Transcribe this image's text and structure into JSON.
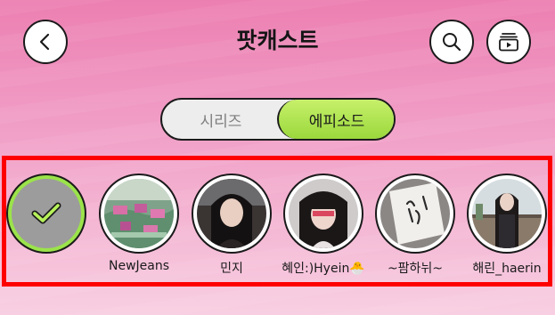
{
  "header": {
    "title": "팟캐스트",
    "back_icon": "chevron-left-icon",
    "search_icon": "search-icon",
    "playlist_icon": "playlist-icon"
  },
  "tabs": {
    "series_label": "시리즈",
    "episode_label": "에피소드",
    "selected": "에피소드"
  },
  "filters": {
    "all_icon": "check-icon",
    "profiles": [
      {
        "name": "NewJeans"
      },
      {
        "name": "민지"
      },
      {
        "name": "혜인:)Hyein🐣"
      },
      {
        "name": "~팜하뉘~"
      },
      {
        "name": "해린_haerin"
      }
    ]
  },
  "colors": {
    "accent_green": "#9be34a",
    "highlight_red": "#ff0000",
    "background_pink": "#ef8fbd"
  }
}
